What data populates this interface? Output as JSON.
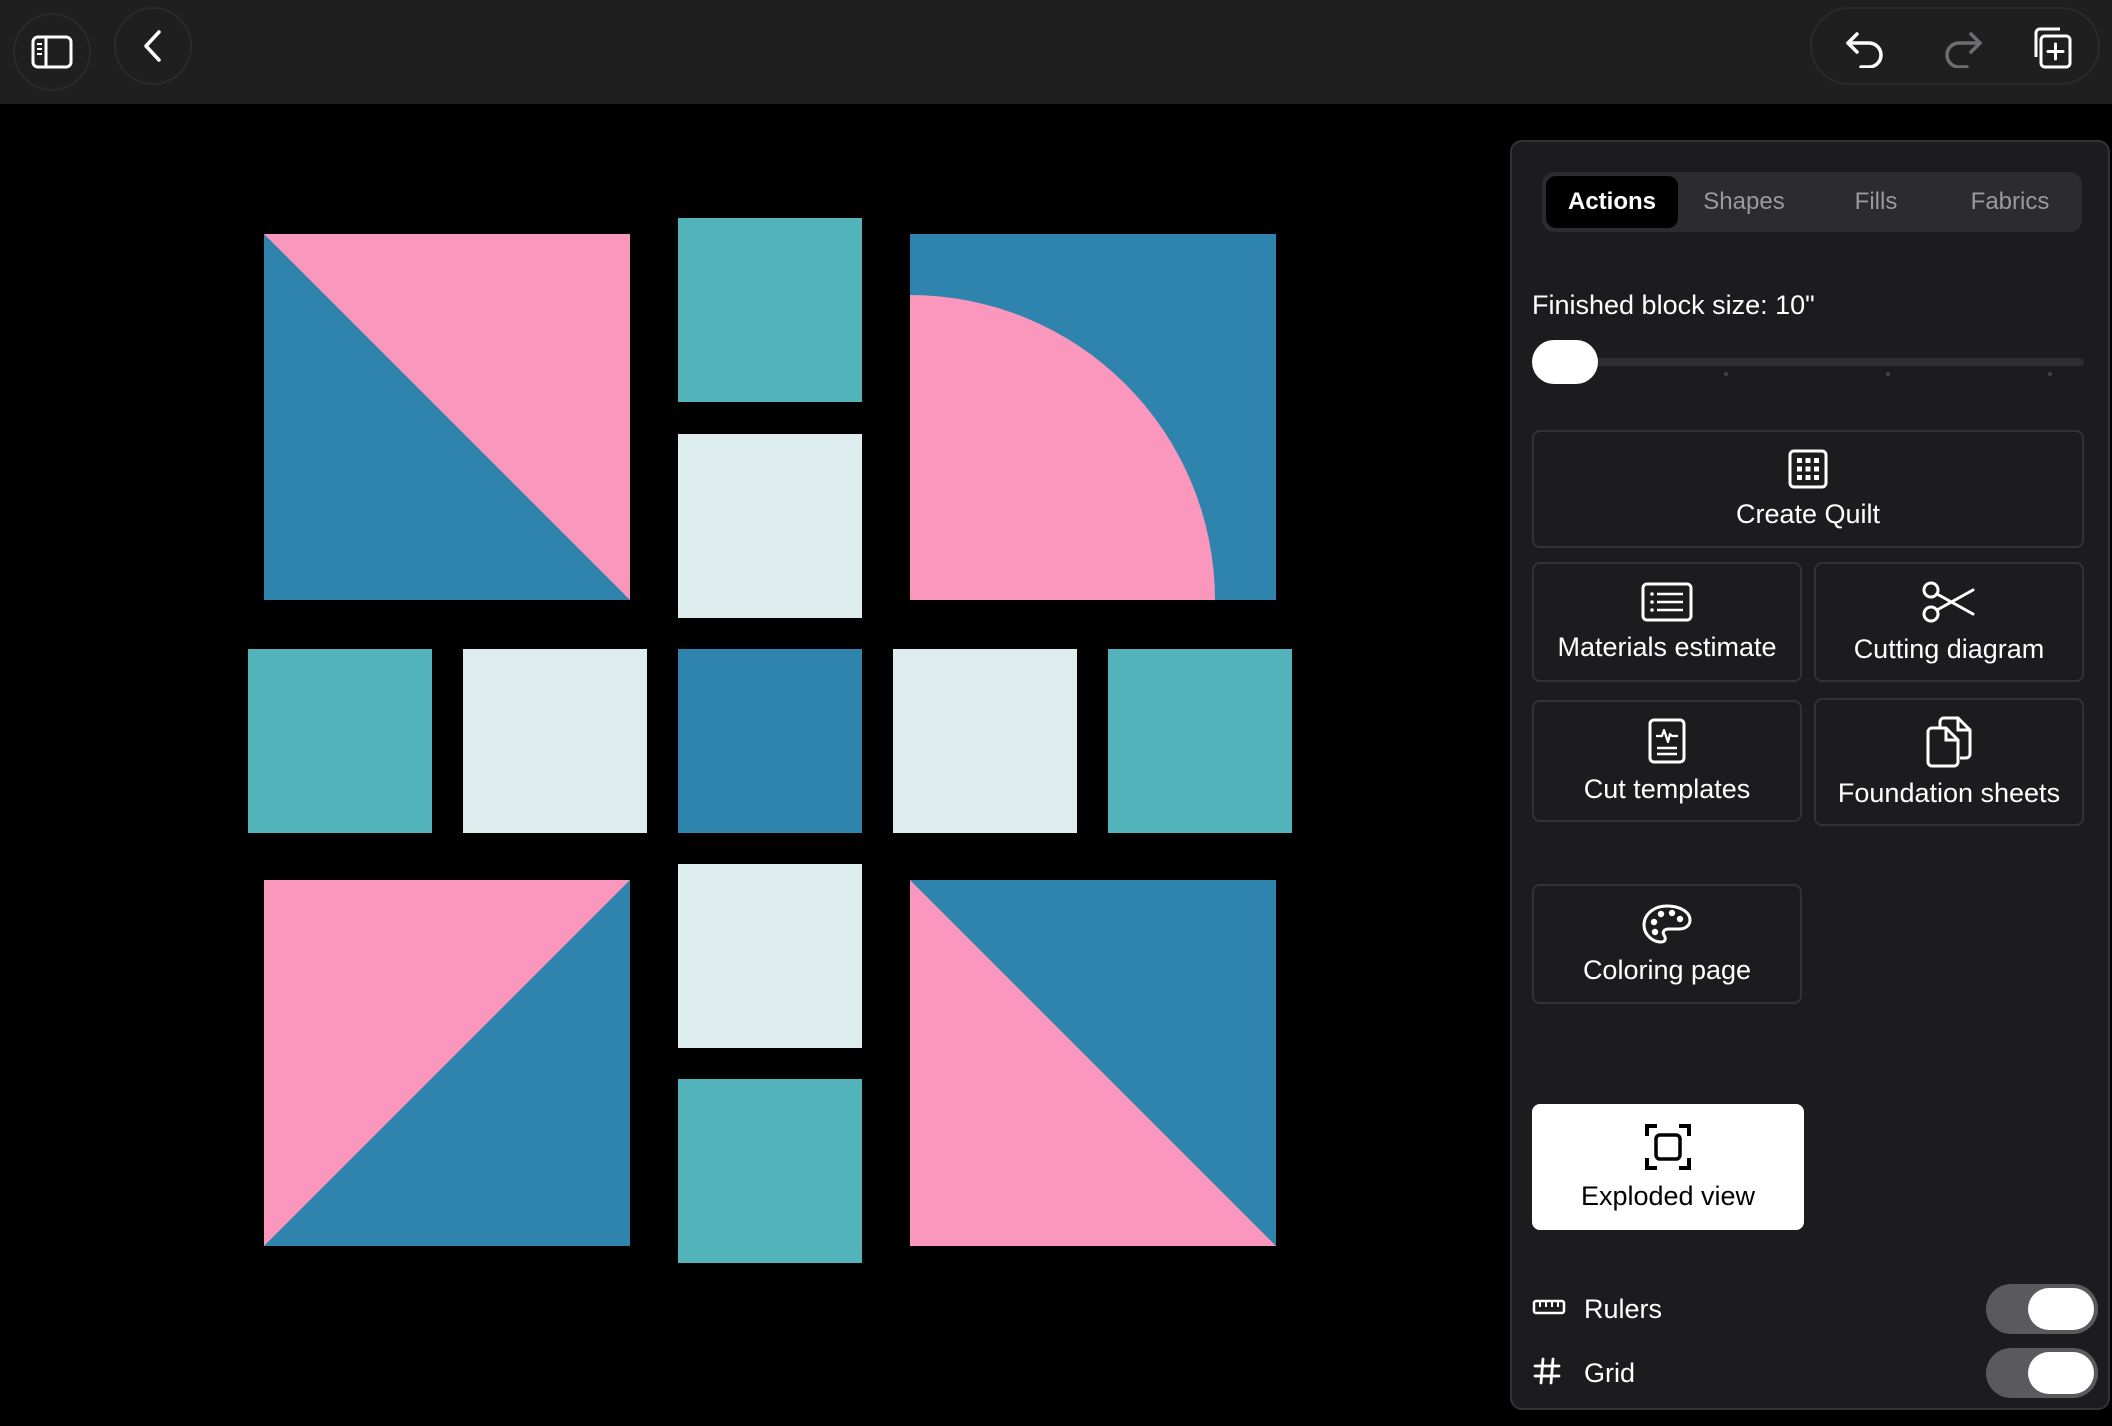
{
  "toolbar": {
    "sidebar_icon": "sidebar-icon",
    "back_icon": "chevron-left-icon",
    "undo_icon": "undo-icon",
    "redo_icon": "redo-icon",
    "duplicate_icon": "duplicate-add-icon"
  },
  "panel": {
    "tabs": [
      {
        "label": "Actions",
        "active": true
      },
      {
        "label": "Shapes",
        "active": false
      },
      {
        "label": "Fills",
        "active": false
      },
      {
        "label": "Fabrics",
        "active": false
      }
    ],
    "block_size_label": "Finished block size: 10\"",
    "slider_value_fraction": 0,
    "actions": {
      "create_quilt": {
        "label": "Create Quilt",
        "icon": "grid-icon"
      },
      "materials_estimate": {
        "label": "Materials estimate",
        "icon": "list-icon"
      },
      "cutting_diagram": {
        "label": "Cutting diagram",
        "icon": "scissors-icon"
      },
      "cut_templates": {
        "label": "Cut templates",
        "icon": "document-icon"
      },
      "foundation_sheets": {
        "label": "Foundation sheets",
        "icon": "documents-icon"
      },
      "coloring_page": {
        "label": "Coloring page",
        "icon": "palette-icon"
      },
      "exploded_view": {
        "label": "Exploded view",
        "icon": "expand-icon"
      }
    },
    "toggles": [
      {
        "label": "Rulers",
        "icon": "ruler-icon",
        "on": true
      },
      {
        "label": "Grid",
        "icon": "hash-icon",
        "on": true
      }
    ]
  },
  "colors": {
    "pink": "#fb96bc",
    "blue": "#2e84ac",
    "teal": "#53b3bb",
    "light": "#ddecec",
    "topbar": "#1f1f1f",
    "panel": "#1c1c1e"
  }
}
